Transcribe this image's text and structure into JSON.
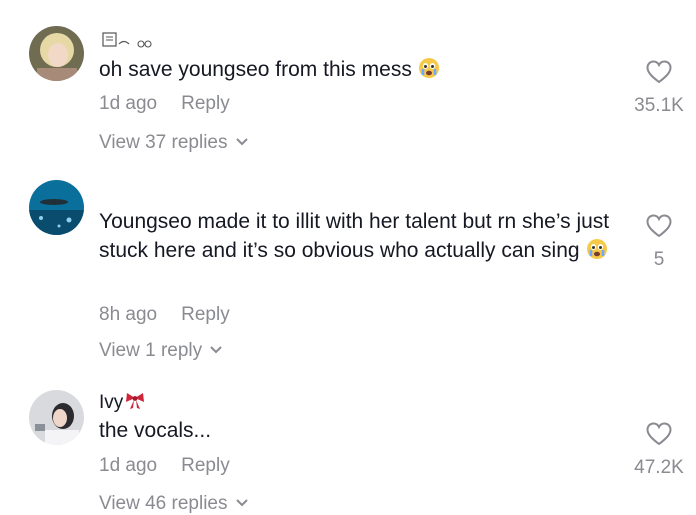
{
  "comments": [
    {
      "username": "",
      "text": "oh save youngseo from this mess",
      "time": "1d ago",
      "reply": "Reply",
      "view_replies": "View 37 replies",
      "likes": "35.1K"
    },
    {
      "username": "",
      "text": "Youngseo made it to illit with her talent but rn she’s just stuck here and it’s so obvious who actually can sing",
      "time": "8h ago",
      "reply": "Reply",
      "view_replies": "View 1 reply",
      "likes": "5"
    },
    {
      "username": "Ivy",
      "text": "the vocals...",
      "time": "1d ago",
      "reply": "Reply",
      "view_replies": "View 46 replies",
      "likes": "47.2K"
    }
  ],
  "icons": {
    "like": "heart-outline-icon",
    "expand": "chevron-down-icon",
    "emoji": "crying-face-emoji",
    "bow": "ribbon-bow-emoji"
  },
  "colors": {
    "text": "#161823",
    "secondary": "#8a8b91",
    "bow": "#d0243a"
  }
}
